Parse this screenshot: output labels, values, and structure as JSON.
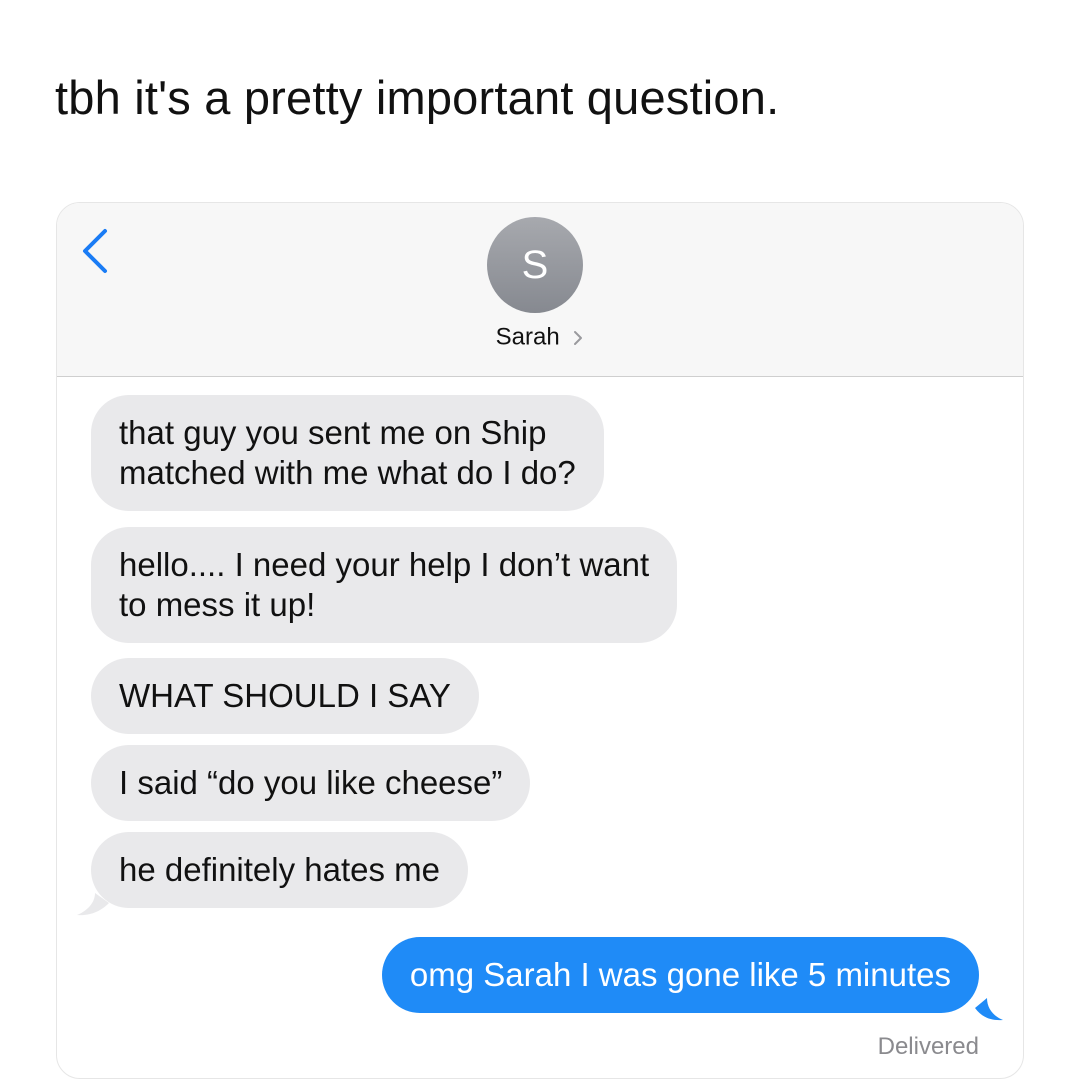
{
  "caption": "tbh it's a pretty important question.",
  "header": {
    "avatar_initial": "S",
    "contact_name": "Sarah"
  },
  "messages": [
    {
      "direction": "incoming",
      "lines": [
        "that guy you sent me on Ship",
        "matched with me what do I do?"
      ]
    },
    {
      "direction": "incoming",
      "lines": [
        "hello.... I need your help I don’t want",
        "to mess it up!"
      ]
    },
    {
      "direction": "incoming",
      "lines": [
        "WHAT SHOULD I SAY"
      ]
    },
    {
      "direction": "incoming",
      "lines": [
        "I said “do you like cheese”"
      ]
    },
    {
      "direction": "incoming",
      "lines": [
        "he definitely hates me"
      ]
    },
    {
      "direction": "outgoing",
      "lines": [
        "omg Sarah I was gone like 5 minutes"
      ]
    }
  ],
  "status": "Delivered",
  "colors": {
    "incoming_bubble": "#e9e9eb",
    "outgoing_bubble": "#1f8bf7",
    "back_arrow": "#1a7cf5",
    "avatar": "#9a9ca1"
  },
  "icons": {
    "back": "chevron-left-icon",
    "contact_detail": "chevron-right-icon"
  }
}
